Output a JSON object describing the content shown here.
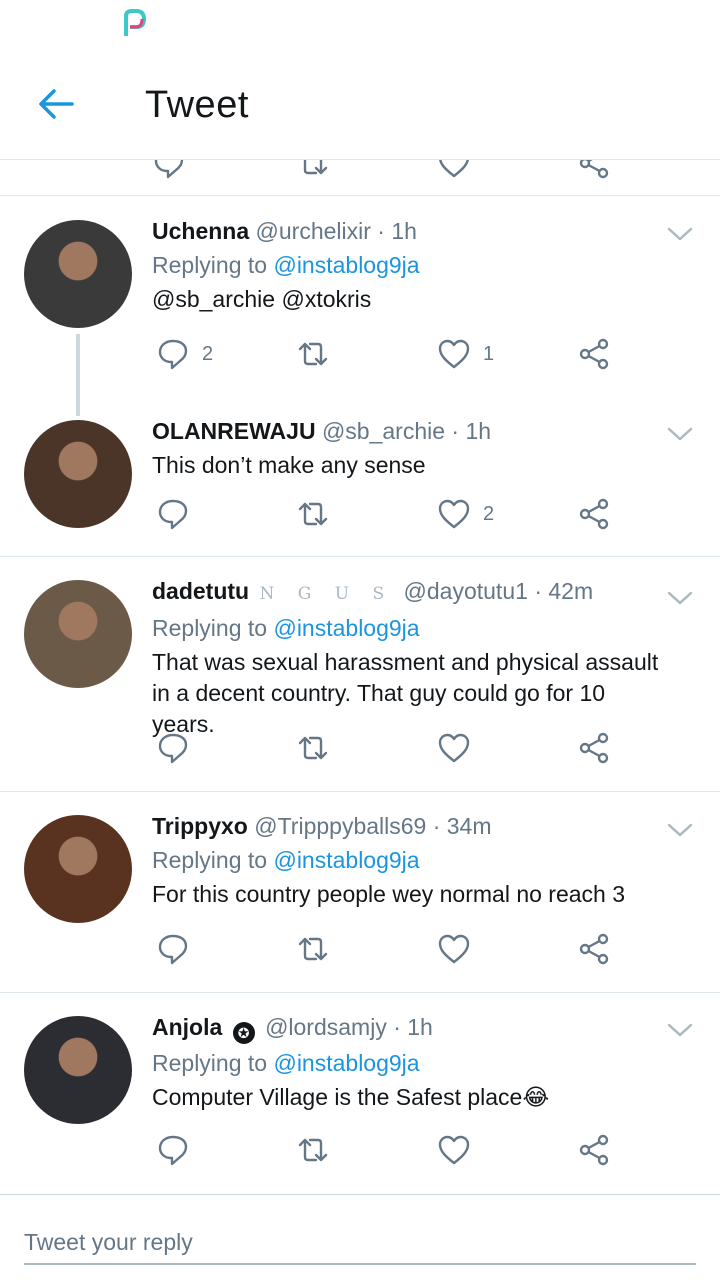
{
  "header": {
    "title": "Tweet"
  },
  "tweets": [
    {
      "name": "Uchenna",
      "badge": "",
      "handle": "@urchelixir",
      "time": "· 1h",
      "replying_prefix": "Replying to",
      "replying_to": "@instablog9ja",
      "text": "@sb_archie @xtokris",
      "replies": "2",
      "retweets": "",
      "likes": "1",
      "avatar_color": "#3a3a3a"
    },
    {
      "name": "OLANREWAJU",
      "badge": "",
      "handle": "@sb_archie",
      "time": "· 1h",
      "replying_prefix": "",
      "replying_to": "",
      "text": "This don’t make any sense",
      "replies": "",
      "retweets": "",
      "likes": "2",
      "avatar_color": "#4a3528"
    },
    {
      "name": "dadetutu",
      "badge": "N G U S",
      "handle": "@dayotutu1",
      "time": "· 42m",
      "replying_prefix": "Replying to",
      "replying_to": "@instablog9ja",
      "text": "That was sexual harassment and physical assault in a decent country. That guy could go for 10 years.",
      "replies": "",
      "retweets": "",
      "likes": "",
      "avatar_color": "#6b5a48"
    },
    {
      "name": "Trippyxo",
      "badge": "",
      "handle": "@Tripppyballs69",
      "time": "· 34m",
      "replying_prefix": "Replying to",
      "replying_to": "@instablog9ja",
      "text": "For this country people wey normal no reach 3",
      "replies": "",
      "retweets": "",
      "likes": "",
      "avatar_color": "#5a3320"
    },
    {
      "name": "Anjola",
      "badge": "✪",
      "handle": "@lordsamjy",
      "time": "· 1h",
      "replying_prefix": "Replying to",
      "replying_to": "@instablog9ja",
      "text": "Computer Village is the Safest place😂",
      "replies": "",
      "retweets": "",
      "likes": "",
      "avatar_color": "#2b2d33"
    }
  ],
  "reply_box": {
    "placeholder": "Tweet your reply"
  },
  "colors": {
    "accent": "#1b95e0",
    "muted": "#657786",
    "divider": "#e1e8ed"
  },
  "icons": [
    "back-arrow-icon",
    "reply-icon",
    "retweet-icon",
    "like-icon",
    "share-icon",
    "chevron-down-icon"
  ]
}
